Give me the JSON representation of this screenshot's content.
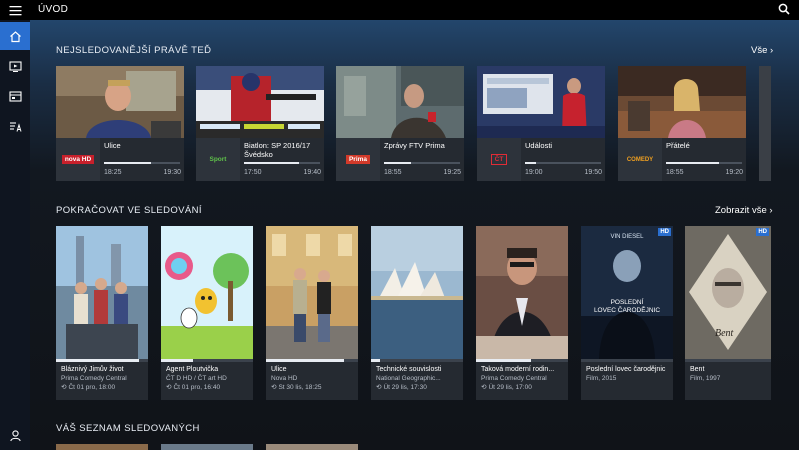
{
  "topbar": {
    "title": "ÚVOD"
  },
  "sections": {
    "live": {
      "title": "NEJSLEDOVANĚJŠÍ PRÁVĚ TEĎ",
      "link": "Vše"
    },
    "continue": {
      "title": "POKRAČOVAT VE SLEDOVÁNÍ",
      "link": "Zobrazit vše"
    },
    "watchlist": {
      "title": "VÁŠ SEZNAM SLEDOVANÝCH"
    }
  },
  "live_cards": [
    {
      "show": "Ulice",
      "channel": "nova HD",
      "start": "18:25",
      "end": "19:30",
      "progress": 0.62
    },
    {
      "show": "Biatlon: SP 2016/17 Švédsko",
      "channel": "Sport",
      "start": "17:50",
      "end": "19:40",
      "progress": 0.72
    },
    {
      "show": "Zprávy FTV Prima",
      "channel": "Prima",
      "start": "18:55",
      "end": "19:25",
      "progress": 0.35
    },
    {
      "show": "Události",
      "channel": "ČT",
      "start": "19:00",
      "end": "19:50",
      "progress": 0.15
    },
    {
      "show": "Přátelé",
      "channel": "COMEDY",
      "start": "18:55",
      "end": "19:20",
      "progress": 0.7
    }
  ],
  "continue_cards": [
    {
      "title": "Bláznivý Jimův život",
      "channel": "Prima Comedy Central",
      "time": "Čt 01 pro, 18:00",
      "progress": 0.9,
      "hd": ""
    },
    {
      "title": "Agent Ploutvička",
      "channel": "ČT D HD / ČT art HD",
      "time": "Čt 01 pro, 16:40",
      "progress": 0.35,
      "hd": ""
    },
    {
      "title": "Ulice",
      "channel": "Nova HD",
      "time": "St 30 lis, 18:25",
      "progress": 0.85,
      "hd": ""
    },
    {
      "title": "Technické souvislosti",
      "channel": "National Geographic...",
      "time": "Út 29 lis, 17:30",
      "progress": 0.1,
      "hd": ""
    },
    {
      "title": "Taková moderní rodin...",
      "channel": "Prima Comedy Central",
      "time": "Út 29 lis, 17:00",
      "progress": 0.6,
      "hd": ""
    },
    {
      "title": "Poslední lovec čarodějnic",
      "channel": "Film, 2015",
      "time": "",
      "progress": 0.0,
      "hd": "HD",
      "poster_text": [
        "VIN DIESEL",
        "POSLEDNÍ",
        "LOVEC ČARODĚJNIC"
      ]
    },
    {
      "title": "Bent",
      "channel": "Film, 1997",
      "time": "",
      "progress": 0.0,
      "hd": "HD",
      "poster_text": [
        "Bent"
      ]
    }
  ],
  "icons": {
    "menu": "hamburger-icon",
    "search": "search-icon",
    "home": "home-icon",
    "tv": "tv-icon",
    "guide": "guide-icon",
    "recordings": "recordings-icon",
    "user": "user-icon",
    "chevron": "chevron-right-icon",
    "replay": "replay-icon"
  },
  "colors": {
    "accent": "#2a6fd0",
    "card": "#252a31",
    "background": "#101318"
  }
}
